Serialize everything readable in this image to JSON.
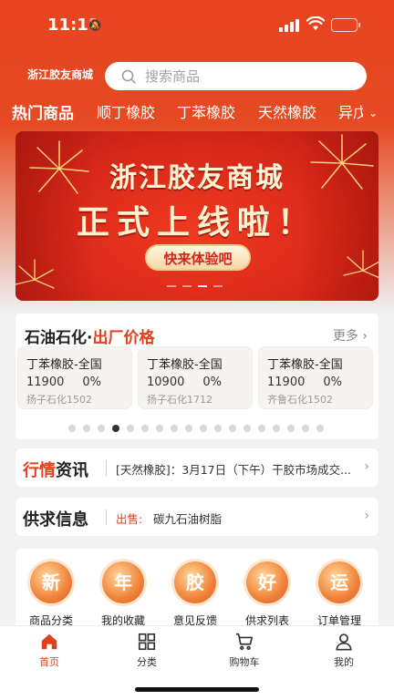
{
  "status": {
    "time": "11:11"
  },
  "header": {
    "brand": "浙江胶友商城",
    "search_placeholder": "搜索商品"
  },
  "tabs": [
    {
      "label": "热门商品",
      "active": true
    },
    {
      "label": "顺丁橡胶"
    },
    {
      "label": "丁苯橡胶"
    },
    {
      "label": "天然橡胶"
    },
    {
      "label": "异戊"
    }
  ],
  "banner": {
    "title": "浙江胶友商城",
    "subtitle": "正式上线啦！",
    "cta": "快来体验吧"
  },
  "prices": {
    "title_a": "石油石化",
    "title_dot": "·",
    "title_b": "出厂价格",
    "more": "更多",
    "items": [
      {
        "name": "丁苯橡胶-全国",
        "price": "11900",
        "change": "0%",
        "source": "扬子石化1502"
      },
      {
        "name": "丁苯橡胶-全国",
        "price": "10900",
        "change": "0%",
        "source": "扬子石化1712"
      },
      {
        "name": "丁苯橡胶-全国",
        "price": "11900",
        "change": "0%",
        "source": "齐鲁石化1502"
      }
    ]
  },
  "news": {
    "title_a": "行情",
    "title_b": "资讯",
    "text": "[天然橡胶]：3月17日（下午）干胶市场成交..."
  },
  "supply": {
    "title": "供求信息",
    "tag": "出售:",
    "text": "碳九石油树脂"
  },
  "shortcuts": [
    {
      "glyph": "新",
      "label": "商品分类"
    },
    {
      "glyph": "年",
      "label": "我的收藏"
    },
    {
      "glyph": "胶",
      "label": "意见反馈"
    },
    {
      "glyph": "好",
      "label": "供求列表"
    },
    {
      "glyph": "运",
      "label": "订单管理"
    }
  ],
  "nav": [
    {
      "label": "首页",
      "icon": "home-icon",
      "active": true
    },
    {
      "label": "分类",
      "icon": "grid-icon"
    },
    {
      "label": "购物车",
      "icon": "cart-icon"
    },
    {
      "label": "我的",
      "icon": "user-icon"
    }
  ],
  "colors": {
    "accent": "#e2401d",
    "header": "#e8441f"
  }
}
